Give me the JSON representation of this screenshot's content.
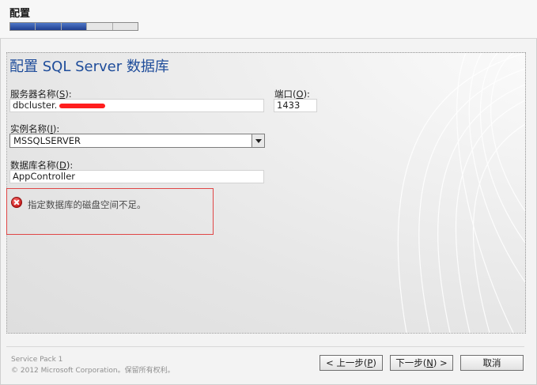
{
  "header": {
    "stage_title": "配置",
    "progress_filled": 3,
    "progress_total": 5
  },
  "page": {
    "title": "配置 SQL Server 数据库"
  },
  "server": {
    "label": "服务器名称(",
    "accesskey": "S",
    "label_end": "):",
    "value": "dbcluster.",
    "redacted": true
  },
  "port": {
    "label": "端口(",
    "accesskey": "O",
    "label_end": "):",
    "value": "1433"
  },
  "instance": {
    "label": "实例名称(",
    "accesskey": "I",
    "label_end": "):",
    "value": "MSSQLSERVER"
  },
  "database": {
    "label": "数据库名称(",
    "accesskey": "D",
    "label_end": "):",
    "value": "AppController"
  },
  "error": {
    "message": "指定数据库的磁盘空间不足。",
    "icon": "error-icon"
  },
  "footer": {
    "service_pack": "Service Pack 1",
    "copyright": "© 2012 Microsoft Corporation。保留所有权利。",
    "back_label": "< 上一步(",
    "back_key": "P",
    "back_end": ")",
    "next_label": "下一步(",
    "next_key": "N",
    "next_end": ") >",
    "cancel_label": "取消"
  },
  "colors": {
    "accent": "#1e4c9a",
    "error": "#e04646",
    "progress": "#1f3e8f"
  }
}
